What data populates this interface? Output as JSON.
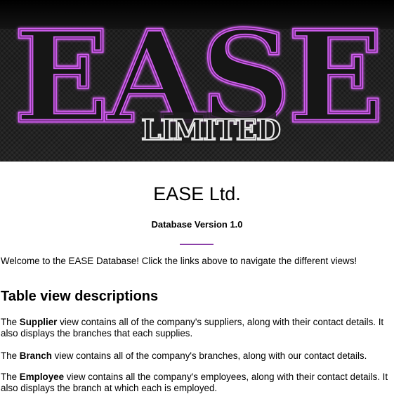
{
  "banner": {
    "logo_main": "EASE",
    "logo_sub": "LIMITED"
  },
  "header": {
    "title": "EASE Ltd.",
    "version": "Database Version 1.0"
  },
  "welcome": "Welcome to the EASE Database! Click the links above to navigate the different views!",
  "descriptions": {
    "heading": "Table view descriptions",
    "supplier": {
      "prefix": "The ",
      "name": "Supplier",
      "text": " view contains all of the company's suppliers, along with their contact details. It also displays the branches that each supplies."
    },
    "branch": {
      "prefix": "The ",
      "name": "Branch",
      "text": " view contains all of the company's branches, along with our contact details."
    },
    "employee": {
      "prefix": "The ",
      "name": "Employee",
      "text": " view contains all the company's employees, along with their contact details. It also displays the branch at which each is employed."
    }
  },
  "colors": {
    "accent": "#8b3fa8",
    "logo_glow": "#c24fe0",
    "banner_bg": "#1f1f1f"
  }
}
